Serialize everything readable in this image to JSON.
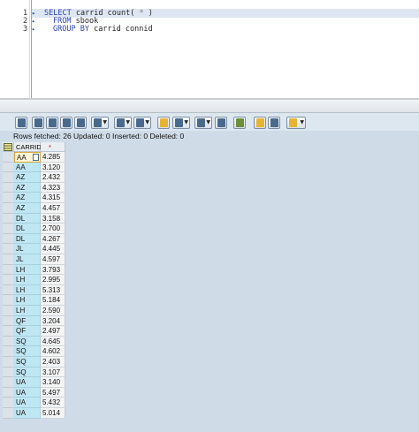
{
  "editor": {
    "lines": [
      {
        "num": "1",
        "kw1": "SELECT",
        "rest1": " carrid count( ",
        "op": "*",
        "rest2": " )"
      },
      {
        "num": "2",
        "kw1": "FROM",
        "rest1": " sbook"
      },
      {
        "num": "3",
        "kw1": "GROUP BY",
        "rest1": " carrid connid"
      }
    ]
  },
  "status": "Rows fetched: 26 Updated: 0 Inserted: 0 Deleted: 0",
  "grid": {
    "headers": [
      "CARRID",
      "*"
    ],
    "rows": [
      [
        "AA",
        "4.285"
      ],
      [
        "AA",
        "3.120"
      ],
      [
        "AZ",
        "2.432"
      ],
      [
        "AZ",
        "4.323"
      ],
      [
        "AZ",
        "4.315"
      ],
      [
        "AZ",
        "4.457"
      ],
      [
        "DL",
        "3.158"
      ],
      [
        "DL",
        "2.700"
      ],
      [
        "DL",
        "4.267"
      ],
      [
        "JL",
        "4.445"
      ],
      [
        "JL",
        "4.597"
      ],
      [
        "LH",
        "3.793"
      ],
      [
        "LH",
        "2.995"
      ],
      [
        "LH",
        "5.313"
      ],
      [
        "LH",
        "5.184"
      ],
      [
        "LH",
        "2.590"
      ],
      [
        "QF",
        "3.204"
      ],
      [
        "QF",
        "2.497"
      ],
      [
        "SQ",
        "4.645"
      ],
      [
        "SQ",
        "4.602"
      ],
      [
        "SQ",
        "2.403"
      ],
      [
        "SQ",
        "3.107"
      ],
      [
        "UA",
        "3.140"
      ],
      [
        "UA",
        "5.497"
      ],
      [
        "UA",
        "5.432"
      ],
      [
        "UA",
        "5.014"
      ]
    ]
  },
  "toolbar": {
    "buttons": [
      "details-icon",
      "sort-asc-icon",
      "sort-desc-icon",
      "find-icon",
      "filter-icon",
      "total-icon",
      "subtotal-icon",
      "print-icon",
      "export-icon",
      "view-icon",
      "layout-icon",
      "graphic-icon",
      "abc-icon",
      "info-icon"
    ]
  }
}
